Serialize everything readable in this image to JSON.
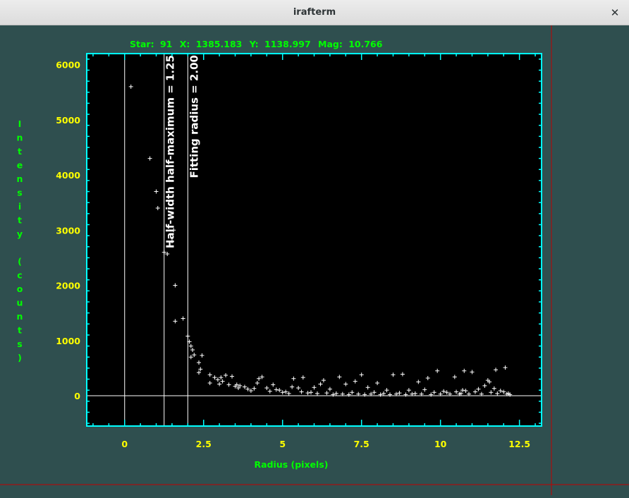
{
  "window": {
    "title": "irafterm",
    "close_glyph": "✕",
    "close_icon": "close-icon"
  },
  "header": {
    "star_label": "Star:",
    "star_value": "91",
    "x_label": "X:",
    "x_value": "1385.183",
    "y_label": "Y:",
    "y_value": "1138.997",
    "mag_label": "Mag:",
    "mag_value": "10.766"
  },
  "colors": {
    "background": "#2f4f4f",
    "plot_background": "#000000",
    "axis": "#00ffff",
    "tick_labels": "#ffff00",
    "axis_titles": "#00ff00",
    "data": "#ffffff",
    "cursor": "#c00000"
  },
  "chart_data": {
    "type": "scatter",
    "title": "Star: 91  X: 1385.183  Y: 1138.997  Mag: 10.766",
    "xlabel": "Radius (pixels)",
    "ylabel": "Intensity (counts)",
    "ylabel_chars": [
      "I",
      "n",
      "t",
      "e",
      "n",
      "s",
      "i",
      "t",
      "y",
      "",
      "(",
      "c",
      "o",
      "u",
      "n",
      "t",
      "s",
      ")"
    ],
    "xlim": [
      -1.2,
      13.2
    ],
    "ylim": [
      -550,
      6200
    ],
    "xticks": [
      {
        "value": 0,
        "label": "0"
      },
      {
        "value": 2.5,
        "label": "2.5"
      },
      {
        "value": 5,
        "label": "5"
      },
      {
        "value": 7.5,
        "label": "7.5"
      },
      {
        "value": 10,
        "label": "10"
      },
      {
        "value": 12.5,
        "label": "12.5"
      }
    ],
    "yticks": [
      {
        "value": 0,
        "label": "0"
      },
      {
        "value": 1000,
        "label": "1000"
      },
      {
        "value": 2000,
        "label": "2000"
      },
      {
        "value": 3000,
        "label": "3000"
      },
      {
        "value": 4000,
        "label": "4000"
      },
      {
        "value": 5000,
        "label": "5000"
      },
      {
        "value": 6000,
        "label": "6000"
      }
    ],
    "baseline": 0,
    "vlines": [
      {
        "x": 0,
        "label": ""
      },
      {
        "x": 1.25,
        "label": "Half-width half-maximum = 1.25"
      },
      {
        "x": 2.0,
        "label": "Fitting radius = 2.00"
      }
    ],
    "points": [
      [
        0.2,
        5600
      ],
      [
        0.8,
        4300
      ],
      [
        1.0,
        3700
      ],
      [
        1.05,
        3400
      ],
      [
        1.25,
        2600
      ],
      [
        1.35,
        2570
      ],
      [
        1.5,
        2800
      ],
      [
        1.55,
        3000
      ],
      [
        1.6,
        2000
      ],
      [
        1.6,
        1350
      ],
      [
        1.85,
        1400
      ],
      [
        2.0,
        1080
      ],
      [
        2.05,
        980
      ],
      [
        2.1,
        900
      ],
      [
        2.15,
        830
      ],
      [
        2.2,
        740
      ],
      [
        2.1,
        700
      ],
      [
        2.35,
        600
      ],
      [
        2.45,
        730
      ],
      [
        2.4,
        480
      ],
      [
        2.35,
        420
      ],
      [
        2.7,
        380
      ],
      [
        2.7,
        230
      ],
      [
        2.85,
        330
      ],
      [
        2.95,
        290
      ],
      [
        3.0,
        210
      ],
      [
        3.05,
        330
      ],
      [
        3.1,
        260
      ],
      [
        3.2,
        370
      ],
      [
        3.3,
        200
      ],
      [
        3.4,
        350
      ],
      [
        3.5,
        170
      ],
      [
        3.55,
        200
      ],
      [
        3.6,
        140
      ],
      [
        3.65,
        180
      ],
      [
        3.8,
        160
      ],
      [
        3.9,
        120
      ],
      [
        4.0,
        90
      ],
      [
        4.1,
        130
      ],
      [
        4.2,
        230
      ],
      [
        4.25,
        310
      ],
      [
        4.35,
        340
      ],
      [
        4.5,
        140
      ],
      [
        4.6,
        80
      ],
      [
        4.7,
        200
      ],
      [
        4.8,
        110
      ],
      [
        4.9,
        100
      ],
      [
        5.0,
        60
      ],
      [
        5.1,
        70
      ],
      [
        5.2,
        40
      ],
      [
        5.3,
        160
      ],
      [
        5.35,
        310
      ],
      [
        5.5,
        140
      ],
      [
        5.6,
        70
      ],
      [
        5.65,
        330
      ],
      [
        5.8,
        50
      ],
      [
        5.9,
        60
      ],
      [
        6.0,
        150
      ],
      [
        6.1,
        40
      ],
      [
        6.2,
        210
      ],
      [
        6.3,
        280
      ],
      [
        6.4,
        50
      ],
      [
        6.5,
        120
      ],
      [
        6.6,
        20
      ],
      [
        6.7,
        40
      ],
      [
        6.8,
        340
      ],
      [
        6.9,
        30
      ],
      [
        7.0,
        210
      ],
      [
        7.1,
        20
      ],
      [
        7.2,
        60
      ],
      [
        7.3,
        260
      ],
      [
        7.4,
        30
      ],
      [
        7.5,
        380
      ],
      [
        7.6,
        20
      ],
      [
        7.7,
        150
      ],
      [
        7.8,
        30
      ],
      [
        7.9,
        60
      ],
      [
        8.0,
        230
      ],
      [
        8.1,
        20
      ],
      [
        8.2,
        40
      ],
      [
        8.3,
        100
      ],
      [
        8.4,
        20
      ],
      [
        8.5,
        380
      ],
      [
        8.6,
        30
      ],
      [
        8.7,
        50
      ],
      [
        8.8,
        390
      ],
      [
        8.9,
        20
      ],
      [
        9.0,
        100
      ],
      [
        9.1,
        30
      ],
      [
        9.2,
        40
      ],
      [
        9.3,
        250
      ],
      [
        9.4,
        30
      ],
      [
        9.5,
        110
      ],
      [
        9.6,
        320
      ],
      [
        9.7,
        20
      ],
      [
        9.8,
        60
      ],
      [
        9.9,
        450
      ],
      [
        10.0,
        30
      ],
      [
        10.1,
        80
      ],
      [
        10.2,
        60
      ],
      [
        10.3,
        30
      ],
      [
        10.45,
        340
      ],
      [
        10.5,
        70
      ],
      [
        10.6,
        30
      ],
      [
        10.65,
        40
      ],
      [
        10.7,
        100
      ],
      [
        10.75,
        450
      ],
      [
        10.8,
        90
      ],
      [
        10.9,
        30
      ],
      [
        11.0,
        430
      ],
      [
        11.1,
        70
      ],
      [
        11.2,
        120
      ],
      [
        11.3,
        30
      ],
      [
        11.4,
        180
      ],
      [
        11.5,
        280
      ],
      [
        11.55,
        250
      ],
      [
        11.6,
        60
      ],
      [
        11.7,
        130
      ],
      [
        11.75,
        470
      ],
      [
        11.8,
        40
      ],
      [
        11.9,
        90
      ],
      [
        12.0,
        70
      ],
      [
        12.05,
        510
      ],
      [
        12.1,
        30
      ],
      [
        12.15,
        40
      ],
      [
        12.2,
        20
      ]
    ]
  }
}
